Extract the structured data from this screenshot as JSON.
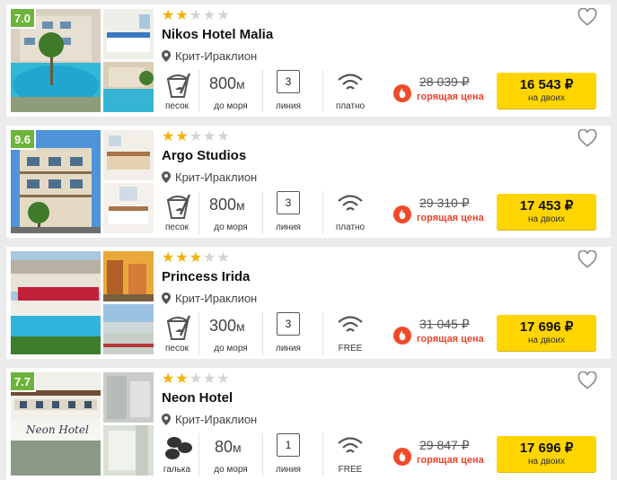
{
  "hotels": [
    {
      "name": "Nikos Hotel Malia",
      "rating": "7.0",
      "stars": 2,
      "location": "Крит-Ираклион",
      "beach": "песок",
      "distance_value": "800",
      "distance_unit": "м",
      "distance_label": "до моря",
      "line_value": "3",
      "line_label": "линия",
      "wifi": "платно",
      "old_price": "28 039 ₽",
      "hot_label": "горящая цена",
      "price": "16 543 ₽",
      "price_sub": "на двоих"
    },
    {
      "name": "Argo Studios",
      "rating": "9.6",
      "stars": 2,
      "location": "Крит-Ираклион",
      "beach": "песок",
      "distance_value": "800",
      "distance_unit": "м",
      "distance_label": "до моря",
      "line_value": "3",
      "line_label": "линия",
      "wifi": "платно",
      "old_price": "29 310 ₽",
      "hot_label": "горящая цена",
      "price": "17 453 ₽",
      "price_sub": "на двоих"
    },
    {
      "name": "Princess Irida",
      "rating": "",
      "stars": 3,
      "location": "Крит-Ираклион",
      "beach": "песок",
      "distance_value": "300",
      "distance_unit": "м",
      "distance_label": "до моря",
      "line_value": "3",
      "line_label": "линия",
      "wifi": "FREE",
      "old_price": "31 045 ₽",
      "hot_label": "горящая цена",
      "price": "17 696 ₽",
      "price_sub": "на двоих"
    },
    {
      "name": "Neon Hotel",
      "rating": "7.7",
      "stars": 2,
      "location": "Крит-Ираклион",
      "beach": "галька",
      "distance_value": "80",
      "distance_unit": "м",
      "distance_label": "до моря",
      "line_value": "1",
      "line_label": "линия",
      "wifi": "FREE",
      "old_price": "29 847 ₽",
      "hot_label": "горящая цена",
      "price": "17 696 ₽",
      "price_sub": "на двоих",
      "photo_sign": "Neon Hotel"
    }
  ],
  "colors": {
    "rating_badge": "#6cb43a",
    "star_on": "#f5b100",
    "star_off": "#d3d3d3",
    "hot": "#e8432a",
    "price_button": "#ffd500"
  },
  "icons": {
    "location": "map-pin-icon",
    "beach_sand": "sand-bucket-icon",
    "beach_pebble": "pebbles-icon",
    "wifi": "wifi-icon",
    "hot": "fire-icon",
    "favorite": "heart-icon"
  }
}
